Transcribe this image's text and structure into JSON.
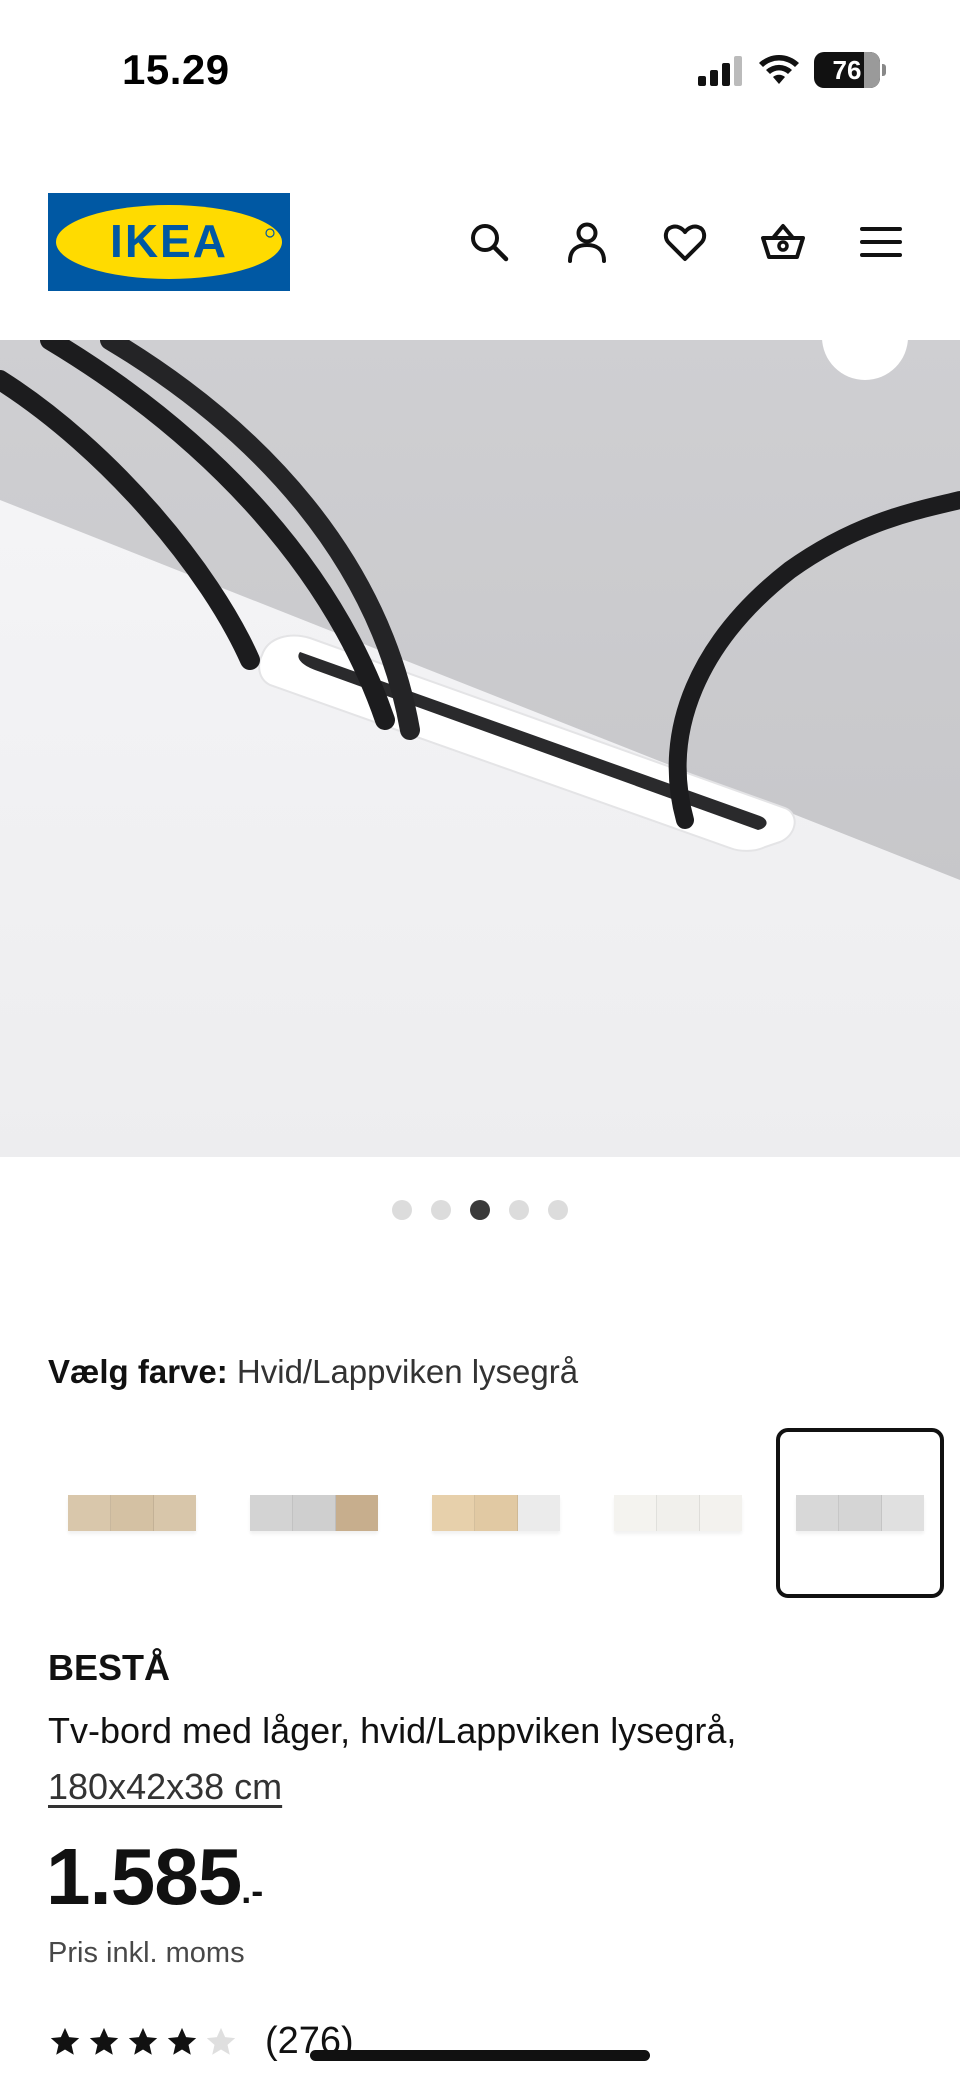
{
  "status_bar": {
    "time": "15.29",
    "battery": "76",
    "icons": [
      "signal-icon",
      "wifi-icon",
      "battery-icon"
    ]
  },
  "header": {
    "logo_text": "IKEA",
    "brand_colors": {
      "blue": "#0058a3",
      "yellow": "#ffdb00"
    },
    "icons": [
      "search-icon",
      "account-icon",
      "heart-icon",
      "basket-icon",
      "menu-icon"
    ]
  },
  "gallery": {
    "image_count": 5,
    "active_index": 2
  },
  "color_picker": {
    "label": "Vælg farve:",
    "value": "Hvid/Lappviken lysegrå",
    "options": [
      {
        "colors": [
          "#d9c7ab",
          "#d4c1a3",
          "#d8c6aa"
        ],
        "selected": false
      },
      {
        "colors": [
          "#d3d3d3",
          "#cfcfcf",
          "#c7ae8d"
        ],
        "selected": false
      },
      {
        "colors": [
          "#e7d0ab",
          "#e1c9a3",
          "#ebebeb"
        ],
        "selected": false
      },
      {
        "colors": [
          "#f4f3ef",
          "#f1f0ec",
          "#f3f2ee"
        ],
        "selected": false
      },
      {
        "colors": [
          "#d8d8d8",
          "#d5d5d5",
          "#e0e0e0"
        ],
        "selected": true
      }
    ]
  },
  "product": {
    "name": "BESTÅ",
    "description": "Tv-bord med låger, hvid/Lappviken lysegrå,",
    "size": "180x42x38 cm",
    "price": "1.585",
    "price_suffix": ".-",
    "price_note": "Pris inkl. moms",
    "rating": 4,
    "rating_max": 5,
    "review_count": "(276)"
  }
}
